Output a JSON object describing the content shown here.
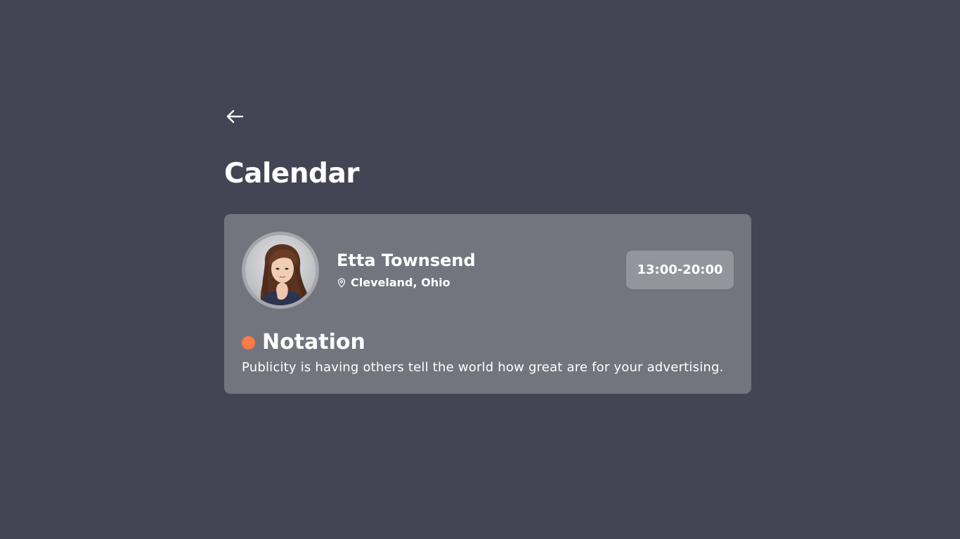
{
  "header": {
    "back_icon": "arrow-left-icon",
    "title": "Calendar"
  },
  "event_card": {
    "person_name": "Etta Townsend",
    "location_icon": "map-pin-icon",
    "location": "Cleveland, Ohio",
    "time": "13:00-20:00",
    "note_title": "Notation",
    "note_text": "Publicity is having others tell the world how great are for your advertising.",
    "status_color": "#ff7a45"
  },
  "colors": {
    "background": "#434554",
    "card": "#73757e",
    "badge": "#94959c"
  }
}
